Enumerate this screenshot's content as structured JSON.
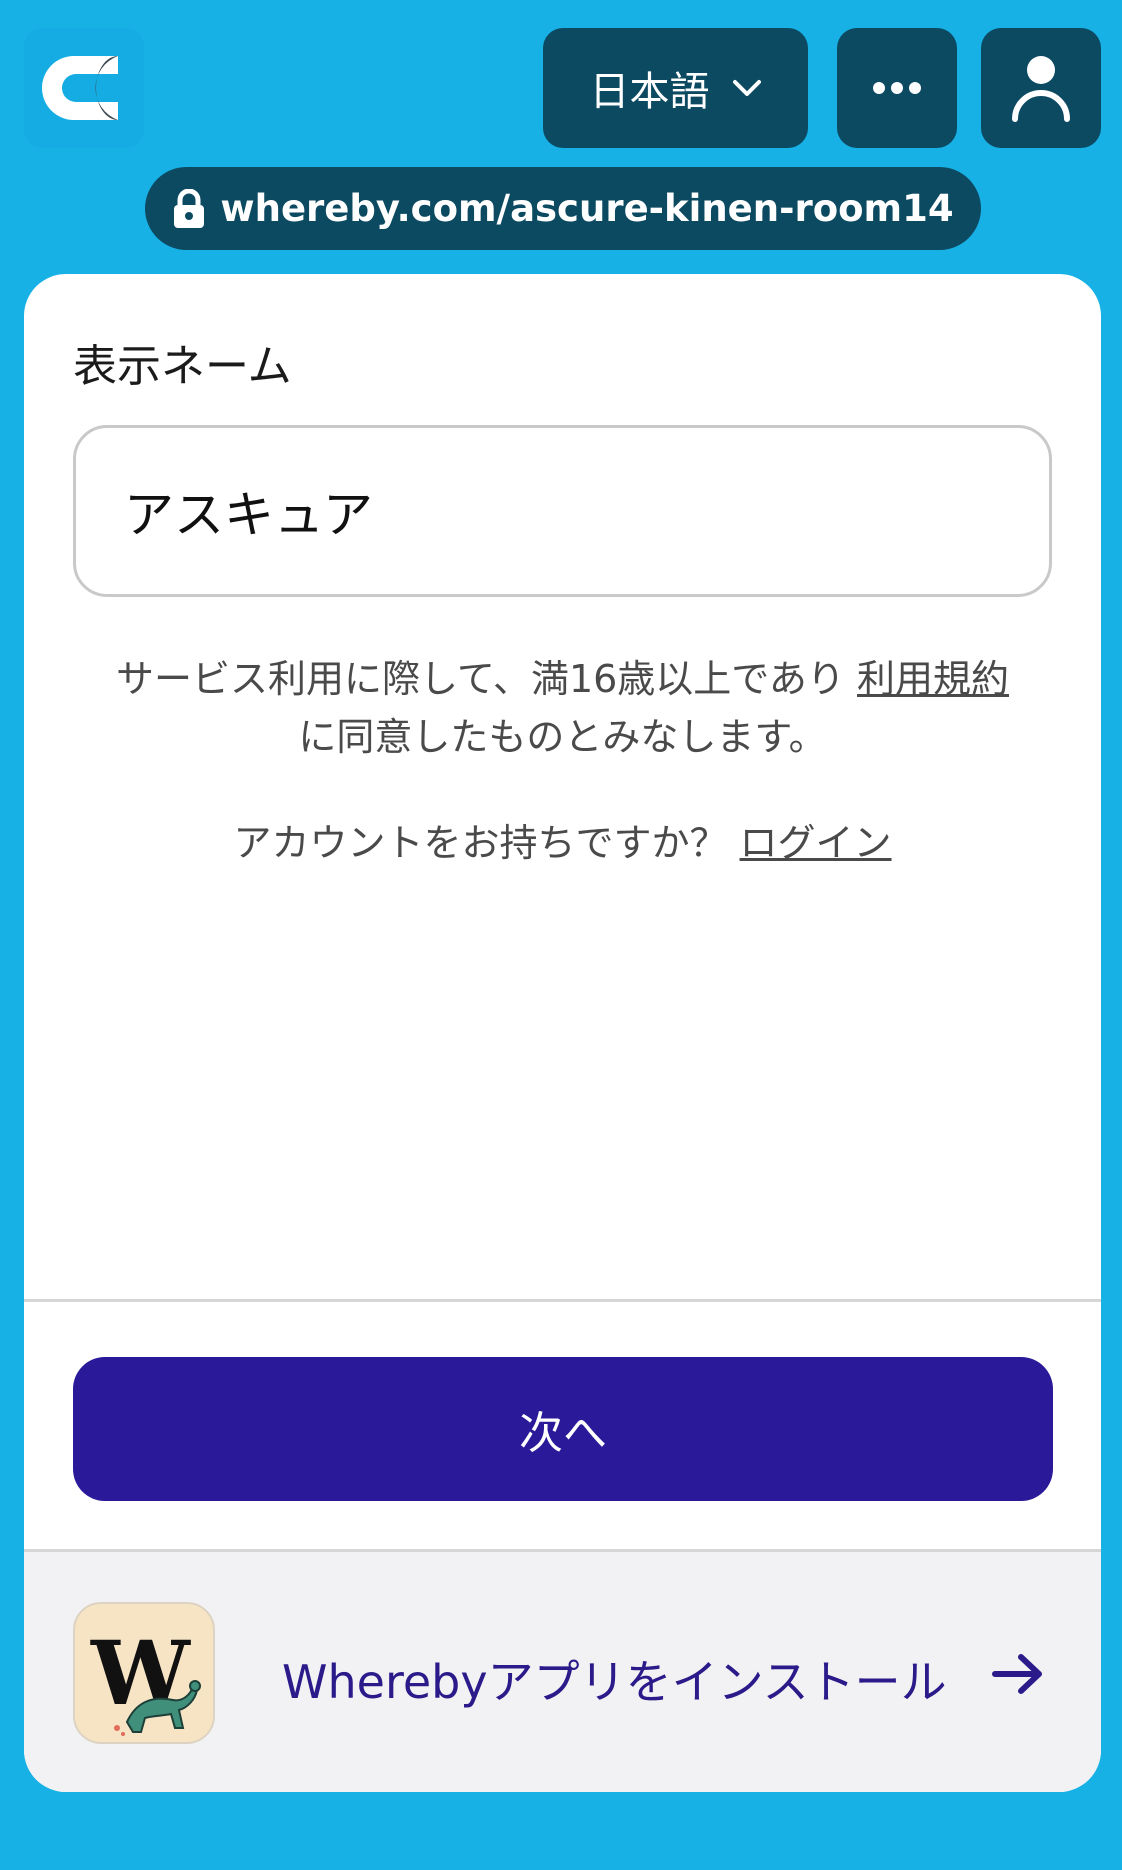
{
  "header": {
    "language_label": "日本語",
    "logo_icon": "whereby-c-logo-icon",
    "more_icon": "more-horizontal-icon",
    "user_icon": "user-icon"
  },
  "url_bar": {
    "url": "whereby.com/ascure-kinen-room14",
    "lock_icon": "lock-icon"
  },
  "form": {
    "display_name_label": "表示ネーム",
    "display_name_value": "アスキュア",
    "terms_prefix": "サービス利用に際して、満16歳以上であり ",
    "terms_link": "利用規約",
    "terms_suffix": "に同意したものとみなします。",
    "account_question": "アカウントをお持ちですか？ ",
    "login_link": "ログイン",
    "next_button": "次へ"
  },
  "install_banner": {
    "text": "Wherebyアプリをインストール",
    "arrow_icon": "arrow-right-icon",
    "app_icon": "whereby-app-icon"
  },
  "colors": {
    "background": "#18b1e6",
    "header_button": "#0c4a62",
    "primary_button": "#2a1a9a",
    "install_text": "#2a1a8a"
  }
}
